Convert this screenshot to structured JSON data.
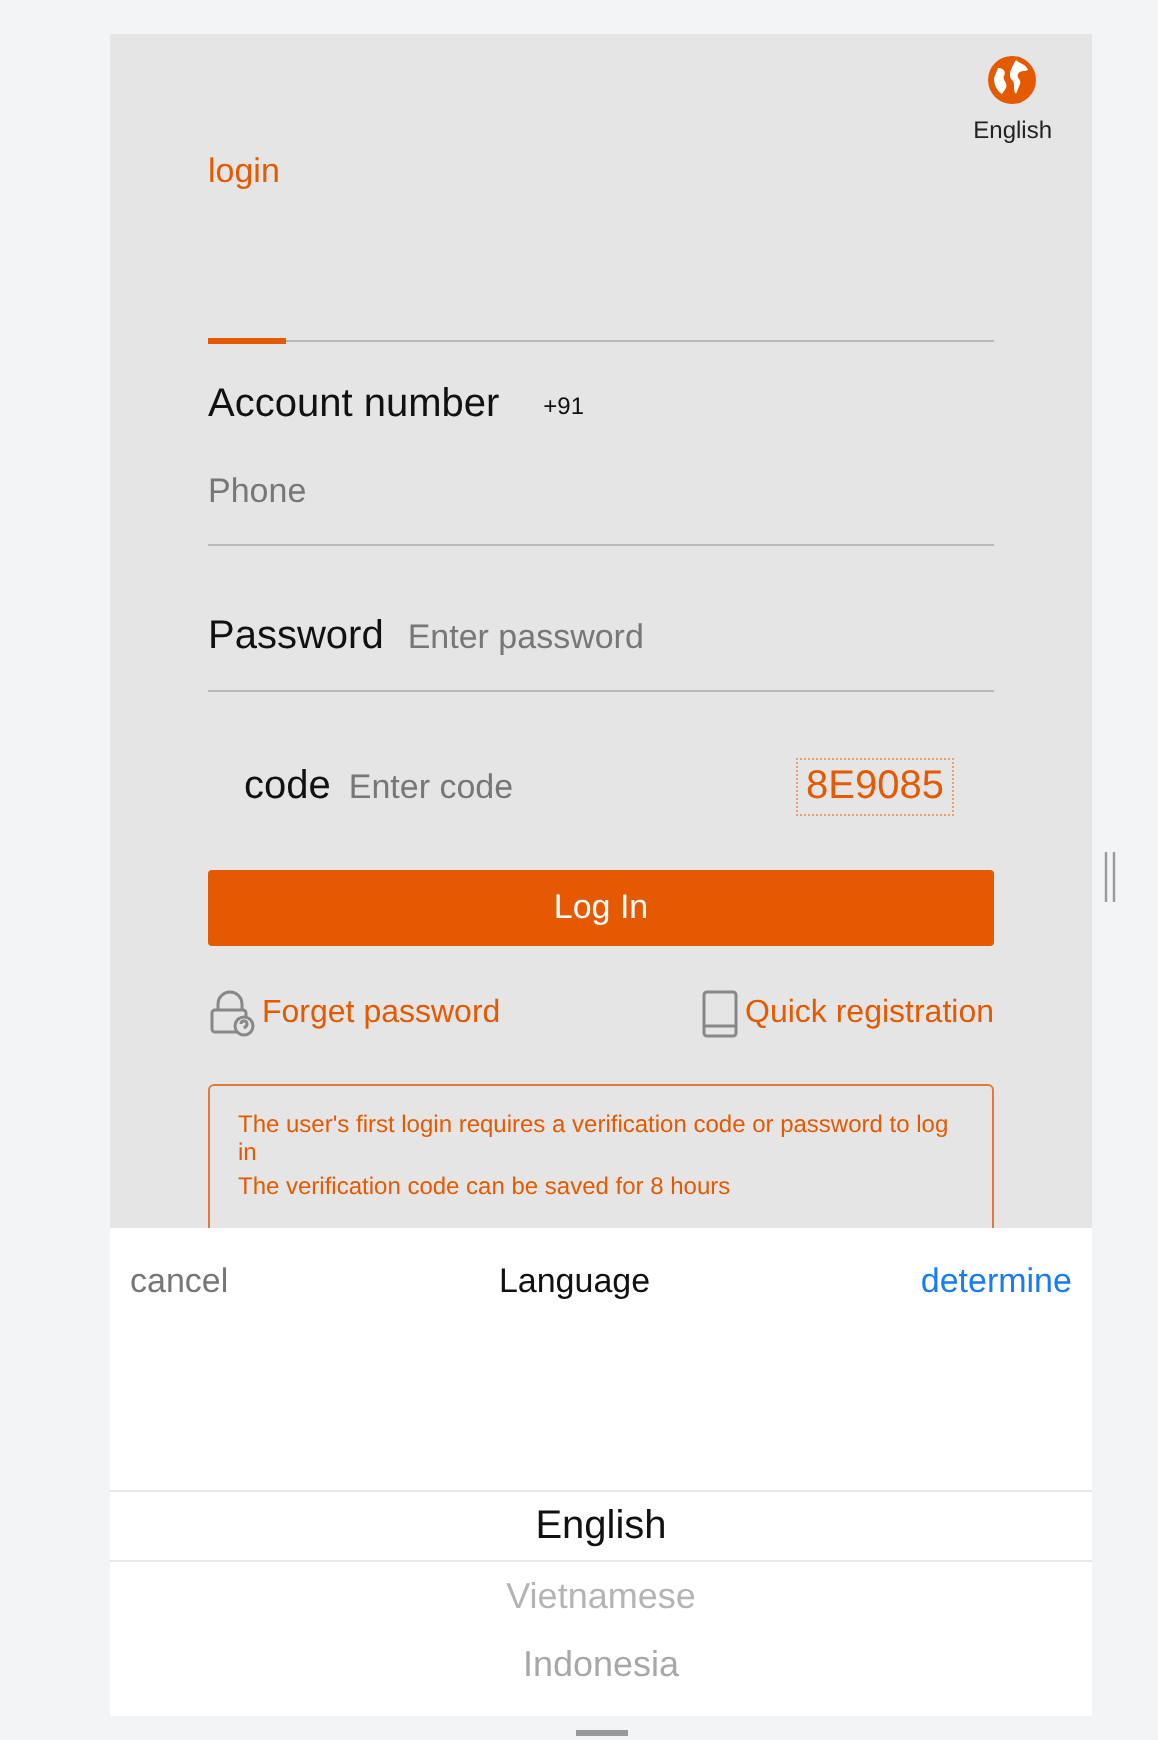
{
  "header": {
    "language": "English"
  },
  "tabs": [
    {
      "label": "login",
      "selected": true
    }
  ],
  "fields": [
    {
      "kind": "phone",
      "label": "Account number",
      "prefix": "+91",
      "placeholder": "Phone"
    },
    {
      "kind": "password",
      "label": "Password",
      "placeholder": "Enter password"
    },
    {
      "kind": "code",
      "label": "code",
      "placeholder": "Enter code",
      "captcha": "8E9085"
    }
  ],
  "login_button": "Log In",
  "links": [
    {
      "kind": "lock",
      "label": "Forget password"
    },
    {
      "kind": "tablet",
      "label": "Quick registration"
    }
  ],
  "notice": [
    "The user's first login requires a verification code or password to log in",
    "The verification code can be saved for 8 hours"
  ],
  "language_picker": {
    "cancel": "cancel",
    "title": "Language",
    "confirm": "determine",
    "options": [
      {
        "label": "English",
        "selected": true
      },
      {
        "label": "Vietnamese",
        "selected": false
      },
      {
        "label": "Indonesia",
        "selected": false
      }
    ]
  }
}
